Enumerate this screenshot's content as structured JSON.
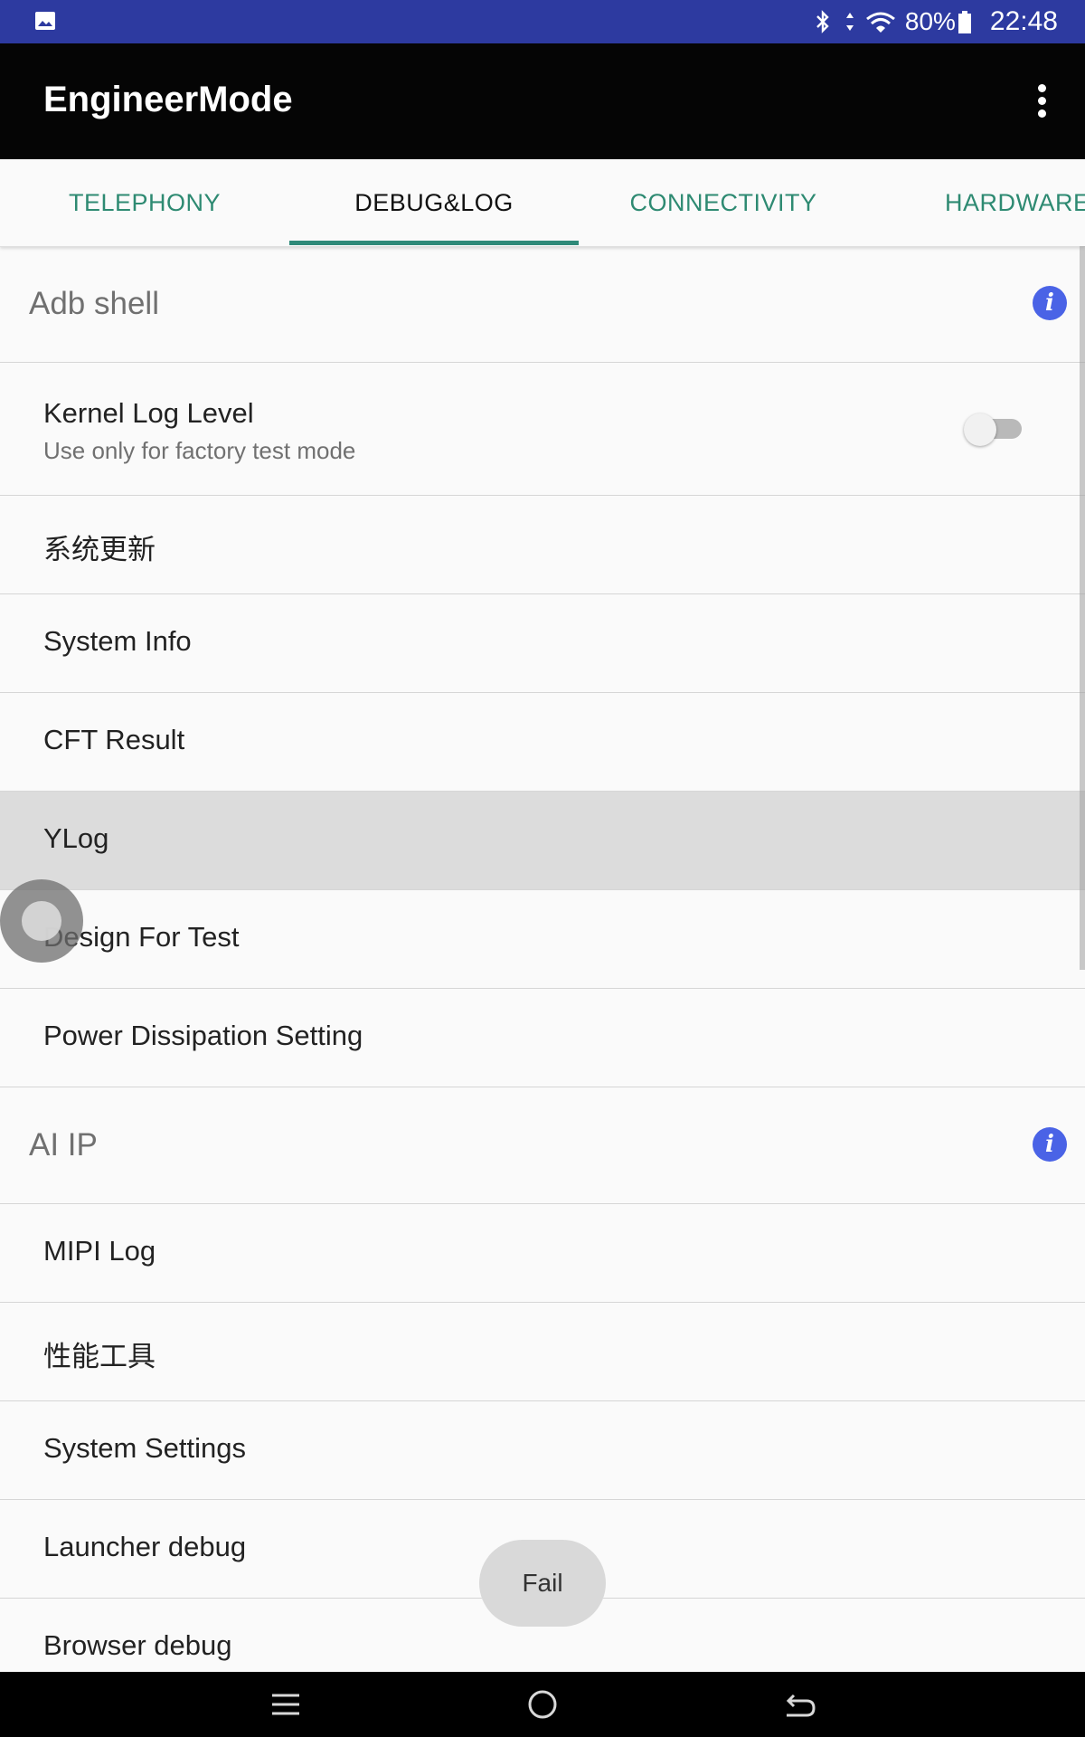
{
  "status_bar": {
    "battery": "80%",
    "time": "22:48",
    "icons": [
      "image-icon",
      "bluetooth-icon",
      "data-arrows-icon",
      "wifi-icon",
      "battery-icon"
    ]
  },
  "app_bar": {
    "title": "EngineerMode",
    "menu_icon": "more-vert-icon"
  },
  "tabs": [
    {
      "label": "TELEPHONY",
      "active": false
    },
    {
      "label": "DEBUG&LOG",
      "active": true
    },
    {
      "label": "CONNECTIVITY",
      "active": false
    },
    {
      "label": "HARDWARE",
      "active": false
    }
  ],
  "colors": {
    "status_bar": "#2d3aa0",
    "app_bar": "#050505",
    "tab_accent": "#2e8a72",
    "info_icon": "#4a63e6"
  },
  "sections": {
    "adb_shell": {
      "header": "Adb shell",
      "kernel_log": {
        "title": "Kernel Log Level",
        "subtitle": "Use only for factory test mode",
        "enabled": false
      },
      "items": [
        "系统更新",
        "System Info",
        "CFT Result",
        "YLog",
        "Design For Test",
        "Power Dissipation Setting"
      ],
      "selected": "YLog"
    },
    "ai_ip": {
      "header": "AI IP",
      "items": [
        "MIPI Log",
        "性能工具",
        "System Settings",
        "Launcher debug",
        "Browser debug"
      ]
    }
  },
  "toast": {
    "text": "Fail"
  },
  "nav_bar": {
    "buttons": [
      "menu-icon",
      "home-icon",
      "back-icon"
    ]
  }
}
